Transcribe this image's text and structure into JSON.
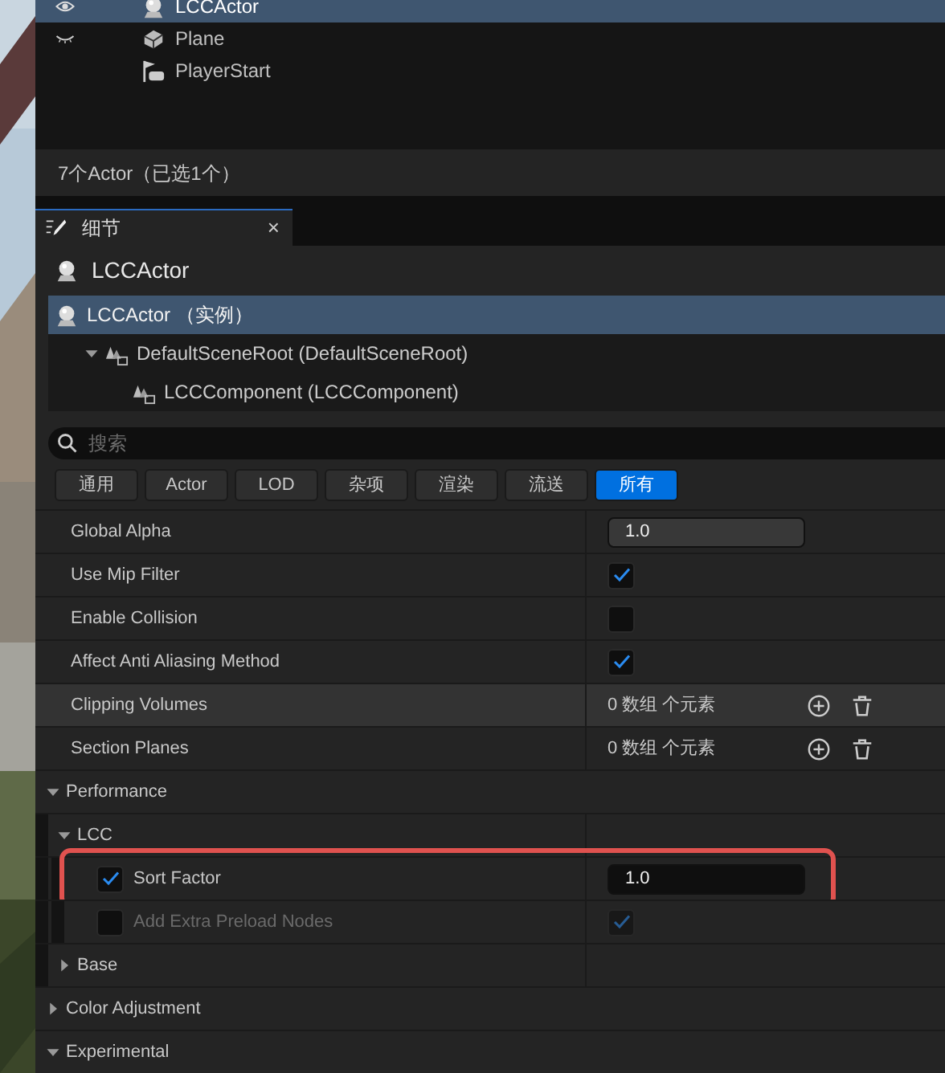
{
  "outliner": {
    "rows": [
      {
        "label": "LCCActor",
        "kind": "actor",
        "visible": true,
        "selected": true
      },
      {
        "label": "Plane",
        "kind": "mesh",
        "visible": false,
        "selected": false
      },
      {
        "label": "PlayerStart",
        "kind": "player-start",
        "selected": false
      }
    ],
    "status": "7个Actor（已选1个）"
  },
  "tab": {
    "label": "细节",
    "close": "×"
  },
  "header": {
    "title": "LCCActor"
  },
  "components": [
    {
      "label": "LCCActor （实例）",
      "kind": "actor",
      "selected": true,
      "children": [
        {
          "label": "DefaultSceneRoot (DefaultSceneRoot)",
          "kind": "component",
          "selected": false,
          "expanded": true,
          "children": [
            {
              "label": "LCCComponent (LCCComponent)",
              "kind": "component",
              "selected": false
            }
          ]
        }
      ]
    }
  ],
  "search": {
    "placeholder": "搜索"
  },
  "filters": [
    {
      "label": "通用",
      "selected": false
    },
    {
      "label": "Actor",
      "selected": false
    },
    {
      "label": "LOD",
      "selected": false
    },
    {
      "label": "杂项",
      "selected": false
    },
    {
      "label": "渲染",
      "selected": false
    },
    {
      "label": "流送",
      "selected": false
    },
    {
      "label": "所有",
      "selected": true
    }
  ],
  "properties": [
    {
      "kind": "number",
      "label": "Global Alpha",
      "value": "1.0"
    },
    {
      "kind": "checkbox",
      "label": "Use Mip Filter",
      "checked": true
    },
    {
      "kind": "checkbox",
      "label": "Enable Collision",
      "checked": false
    },
    {
      "kind": "checkbox",
      "label": "Affect Anti Aliasing Method",
      "checked": true
    },
    {
      "kind": "array",
      "label": "Clipping Volumes",
      "value": "0 数组 个元素",
      "hovered": true
    },
    {
      "kind": "array",
      "label": "Section Planes",
      "value": "0 数组 个元素",
      "hovered": false
    },
    {
      "kind": "category",
      "label": "Performance",
      "expanded": true,
      "children": [
        {
          "kind": "category",
          "label": "LCC",
          "expanded": true,
          "children": [
            {
              "kind": "number",
              "label": "Sort Factor",
              "value": "1.0",
              "edit_checked": true,
              "disabled": false,
              "highlighted": true
            },
            {
              "kind": "checkbox",
              "label": "Add Extra Preload Nodes",
              "checked": true,
              "edit_checked": false,
              "disabled": true,
              "highlighted": false
            }
          ]
        },
        {
          "kind": "category",
          "label": "Base",
          "expanded": false
        }
      ]
    },
    {
      "kind": "category",
      "label": "Color Adjustment",
      "expanded": false
    },
    {
      "kind": "category",
      "label": "Experimental",
      "expanded": true
    }
  ]
}
